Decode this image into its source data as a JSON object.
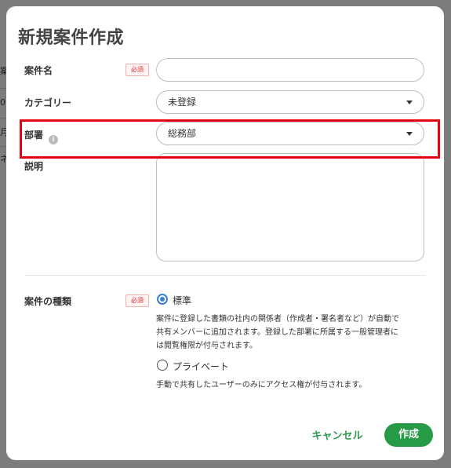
{
  "background": {
    "fragments": [
      "案",
      "0",
      "月",
      "ネ"
    ]
  },
  "dialog": {
    "title": "新規案件作成",
    "fields": {
      "name": {
        "label": "案件名",
        "required_badge": "必須",
        "value": ""
      },
      "category": {
        "label": "カテゴリー",
        "value": "未登録"
      },
      "department": {
        "label": "部署",
        "info_icon": "i",
        "value": "総務部"
      },
      "description": {
        "label": "説明",
        "value": ""
      }
    },
    "case_type": {
      "label": "案件の種類",
      "required_badge": "必須",
      "options": [
        {
          "label": "標準",
          "selected": true,
          "description_lines": [
            "案件に登録した書類の社内の関係者（作成者・署名者など）が自動で",
            "共有メンバーに追加されます。登録した部署に所属する一般管理者に",
            "は閲覧権限が付与されます。"
          ]
        },
        {
          "label": "プライベート",
          "selected": false,
          "description_lines": [
            "手動で共有したユーザーのみにアクセス権が付与されます。"
          ]
        }
      ]
    },
    "buttons": {
      "cancel": "キャンセル",
      "create": "作成"
    }
  },
  "colors": {
    "accent_green": "#279a46",
    "highlight_red": "#e60012",
    "radio_blue": "#3b7ed9",
    "required_red": "#e03030"
  }
}
